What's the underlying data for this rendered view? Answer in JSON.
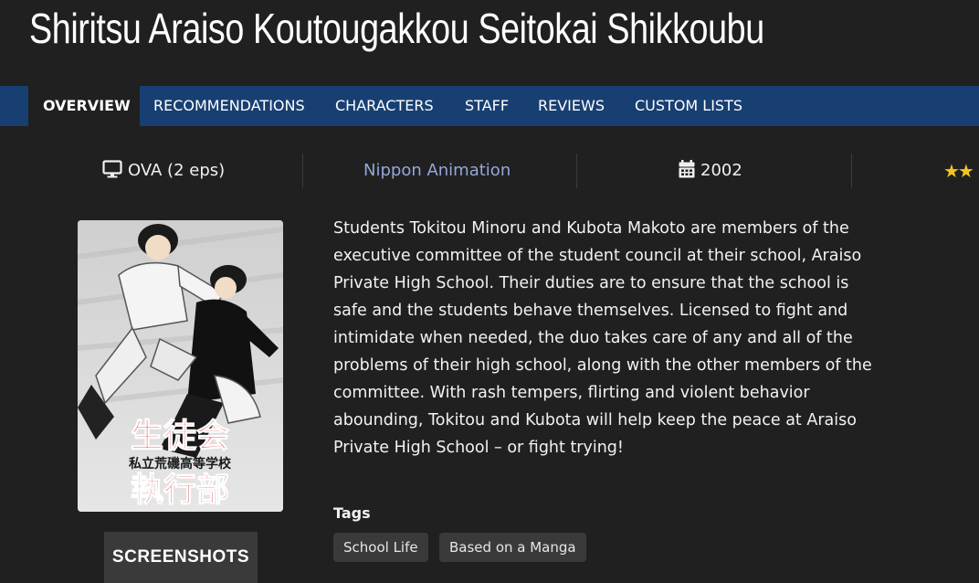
{
  "page": {
    "title": "Shiritsu Araiso Koutougakkou Seitokai Shikkoubu"
  },
  "tabs": [
    {
      "label": "OVERVIEW",
      "active": true
    },
    {
      "label": "RECOMMENDATIONS"
    },
    {
      "label": "CHARACTERS"
    },
    {
      "label": "STAFF"
    },
    {
      "label": "REVIEWS"
    },
    {
      "label": "CUSTOM LISTS"
    }
  ],
  "info": {
    "format": {
      "icon": "monitor-icon",
      "text": "OVA (2 eps)"
    },
    "studio": "Nippon Animation",
    "year": {
      "icon": "calendar-icon",
      "text": "2002"
    },
    "rating": {
      "icon": "star-icon",
      "text": "★★"
    }
  },
  "poster": {
    "title_line1": "生徒会",
    "title_line2": "執行部",
    "subtitle": "私立荒磯高等学校"
  },
  "synopsis": "Students Tokitou Minoru and Kubota Makoto are members of the executive committee of the student council at their school, Araiso Private High School. Their duties are to ensure that the school is safe and the students behave themselves. Licensed to fight and intimidate when needed, the duo takes care of any and all of the problems of their high school, along with the other members of the committee. With rash tempers, flirting and violent behavior abounding, Tokitou and Kubota will help keep the peace at Araiso Private High School – or fight trying!",
  "screenshots_label": "SCREENSHOTS",
  "tags": {
    "label": "Tags",
    "items": [
      "School Life",
      "Based on a Manga"
    ]
  },
  "colors": {
    "background": "#202020",
    "tabbar": "#183f72",
    "studio_link": "#93a8d8",
    "star": "#f2c521"
  }
}
